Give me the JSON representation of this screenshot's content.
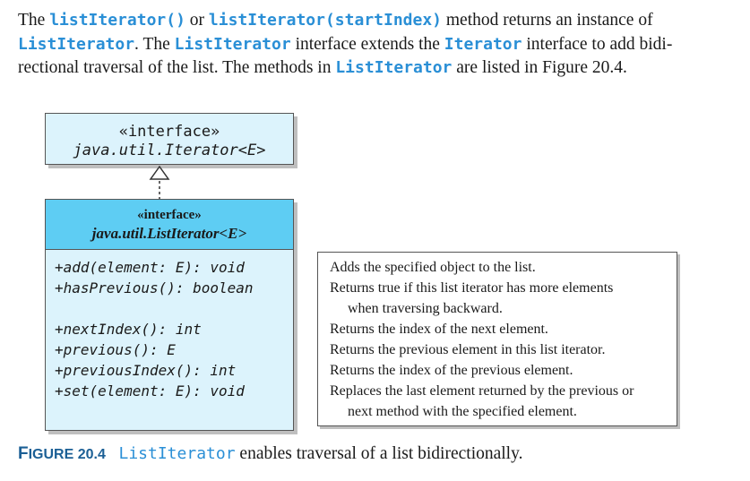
{
  "paragraph": {
    "l1_a": "The ",
    "l1_code1": "listIterator()",
    "l1_b": " or ",
    "l1_code2": "listIterator(startIndex)",
    "l1_c": " method returns an instance of",
    "l2_code1": "ListIterator",
    "l2_a": ". The ",
    "l2_code2": "ListIterator",
    "l2_b": " interface extends the ",
    "l2_code3": "Iterator",
    "l2_c": " interface to add bidi-",
    "l3_a": "rectional traversal of the list. The methods in ",
    "l3_code": "ListIterator",
    "l3_b": " are listed in Figure 20.4."
  },
  "iterator_box": {
    "stereotype": "«interface»",
    "name": "java.util.Iterator<E>"
  },
  "listiterator_box": {
    "stereotype": "«interface»",
    "name": "java.util.ListIterator<E>",
    "methods_group1": [
      "+add(element: E): void",
      "+hasPrevious(): boolean"
    ],
    "methods_group2": [
      "+nextIndex(): int",
      "+previous(): E",
      "+previousIndex(): int",
      "+set(element: E): void"
    ]
  },
  "descriptions": {
    "d1": "Adds the specified object to the list.",
    "d2": "Returns true if this list iterator has more elements",
    "d2b": "when traversing backward.",
    "d3": "Returns the index of the next element.",
    "d4": "Returns the previous element in this list iterator.",
    "d5": "Returns the index of the previous element.",
    "d6": "Replaces the last element returned by the previous or",
    "d6b": "next method with the specified element."
  },
  "caption": {
    "figure_F": "F",
    "figure_rest": "IGURE 20.4",
    "code": "ListIterator",
    "text": " enables traversal of a list bidirectionally."
  },
  "colors": {
    "code_blue": "#2a8fd6",
    "box_light": "#dcf3fc",
    "box_header": "#5ecdf3",
    "caption_blue": "#1b5f95"
  }
}
